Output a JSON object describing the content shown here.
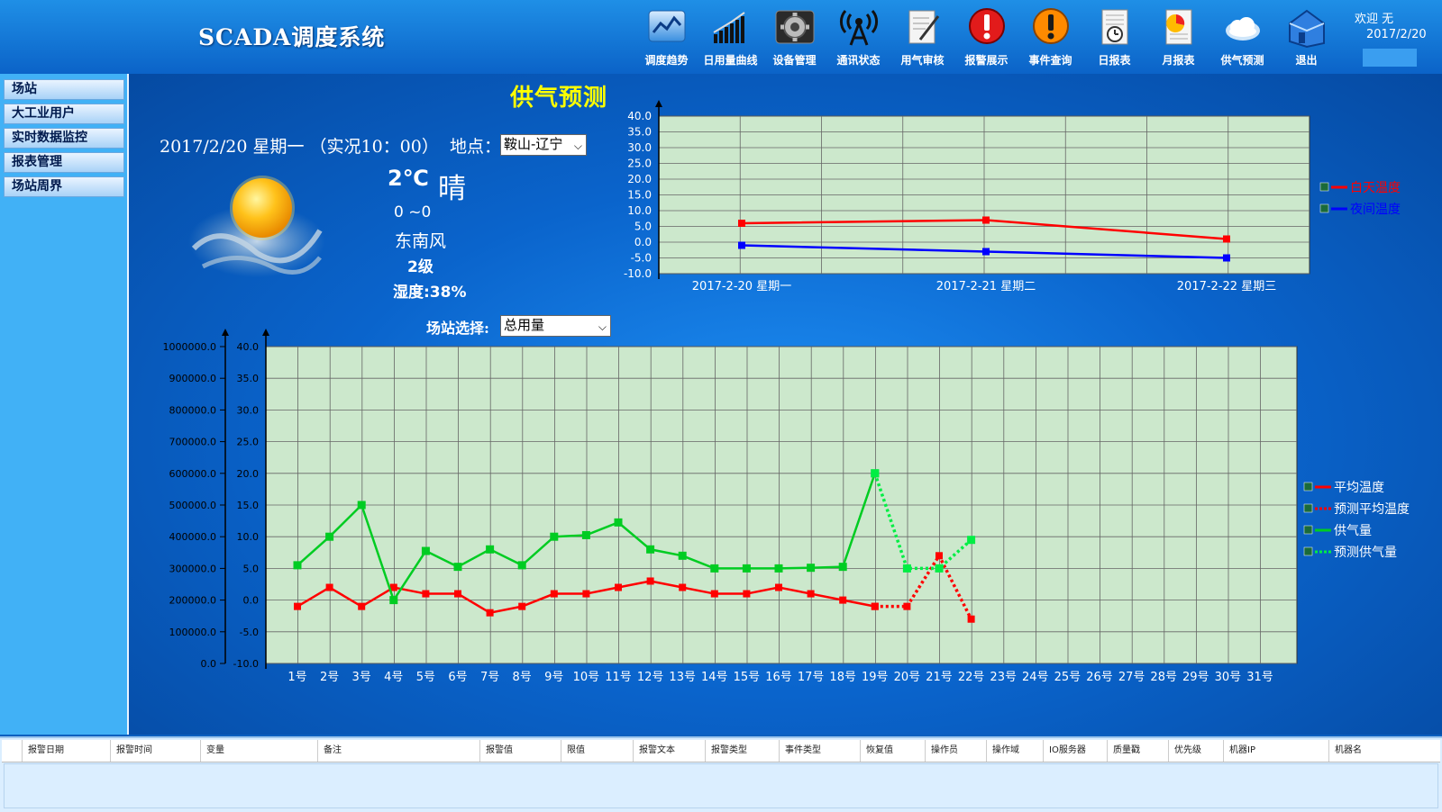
{
  "header": {
    "title": "SCADA调度系统",
    "welcome": "欢迎 无",
    "date": "2017/2/20",
    "toolbar": [
      {
        "label": "调度趋势",
        "icon": "trend-chart-icon"
      },
      {
        "label": "日用量曲线",
        "icon": "bar-chart-icon"
      },
      {
        "label": "设备管理",
        "icon": "gear-icon"
      },
      {
        "label": "通讯状态",
        "icon": "antenna-icon"
      },
      {
        "label": "用气审核",
        "icon": "document-pen-icon"
      },
      {
        "label": "报警展示",
        "icon": "alarm-icon"
      },
      {
        "label": "事件查询",
        "icon": "warning-icon"
      },
      {
        "label": "日报表",
        "icon": "daily-report-icon"
      },
      {
        "label": "月报表",
        "icon": "monthly-report-icon"
      },
      {
        "label": "供气预测",
        "icon": "cloud-icon"
      },
      {
        "label": "退出",
        "icon": "house-exit-icon"
      }
    ]
  },
  "sidebar": {
    "items": [
      {
        "label": "场站"
      },
      {
        "label": "大工业用户"
      },
      {
        "label": "实时数据监控"
      },
      {
        "label": "报表管理"
      },
      {
        "label": "场站周界"
      }
    ]
  },
  "main": {
    "title": "供气预测",
    "date_line": "2017/2/20  星期一  （实况10：00）",
    "location_label": "地点：",
    "location_value": "鞍山-辽宁",
    "weather": {
      "temp": "2℃",
      "condition": "晴",
      "range": "0  ~0",
      "wind": "东南风",
      "level": "2级",
      "humidity": "湿度:38%",
      "icon": "sun-icon"
    },
    "station_label": "场站选择:",
    "station_value": "总用量"
  },
  "colors": {
    "red": "#ff0000",
    "blue": "#0000ff",
    "green": "#00cc22",
    "plot_bg": "#cce8cc"
  },
  "chart_data": [
    {
      "type": "line",
      "categories": [
        "2017-2-20 星期一",
        "2017-2-21 星期二",
        "2017-2-22 星期三"
      ],
      "ylim": [
        -10,
        40
      ],
      "yticks": [
        "40.0",
        "35.0",
        "30.0",
        "25.0",
        "20.0",
        "15.0",
        "10.0",
        "5.0",
        "0.0",
        "-5.0",
        "-10.0"
      ],
      "grid": true,
      "legend_placement": "right",
      "series": [
        {
          "name": "白天温度",
          "color": "#ff0000",
          "style": "solid",
          "values": [
            6,
            7,
            1
          ]
        },
        {
          "name": "夜间温度",
          "color": "#0000ff",
          "style": "solid",
          "values": [
            -1,
            -3,
            -5
          ]
        }
      ]
    },
    {
      "type": "line",
      "categories": [
        "1号",
        "2号",
        "3号",
        "4号",
        "5号",
        "6号",
        "7号",
        "8号",
        "9号",
        "10号",
        "11号",
        "12号",
        "13号",
        "14号",
        "15号",
        "16号",
        "17号",
        "18号",
        "19号",
        "20号",
        "21号",
        "22号",
        "23号",
        "24号",
        "25号",
        "26号",
        "27号",
        "28号",
        "29号",
        "30号",
        "31号"
      ],
      "ylim_left": [
        0,
        1000000
      ],
      "yticks_left": [
        "1000000.0",
        "900000.0",
        "800000.0",
        "700000.0",
        "600000.0",
        "500000.0",
        "400000.0",
        "300000.0",
        "200000.0",
        "100000.0",
        "0.0"
      ],
      "ylim_right": [
        -10,
        40
      ],
      "yticks_right": [
        "40.0",
        "35.0",
        "30.0",
        "25.0",
        "20.0",
        "15.0",
        "10.0",
        "5.0",
        "0.0",
        "-5.0",
        "-10.0"
      ],
      "grid": true,
      "legend_placement": "right",
      "series": [
        {
          "name": "平均温度",
          "color": "#ff0000",
          "style": "solid",
          "axis": "right",
          "x_start": 1,
          "values": [
            -1,
            2,
            -1,
            2,
            1,
            1,
            -2,
            -1,
            1,
            1,
            2,
            3,
            2,
            1,
            1,
            2,
            1,
            0,
            -1
          ]
        },
        {
          "name": "预测平均温度",
          "color": "#ff0000",
          "style": "dotted",
          "axis": "right",
          "x_start": 19,
          "values": [
            -1,
            -1,
            7,
            -3
          ]
        },
        {
          "name": "供气量",
          "color": "#00cc22",
          "style": "solid",
          "axis": "left",
          "x_start": 1,
          "values": [
            310000,
            400000,
            500000,
            200000,
            355000,
            305000,
            360000,
            310000,
            400000,
            405000,
            445000,
            360000,
            340000,
            300000,
            300000,
            300000,
            302000,
            305000,
            600000
          ]
        },
        {
          "name": "预测供气量",
          "color": "#00ee44",
          "style": "dotted",
          "axis": "left",
          "x_start": 19,
          "values": [
            600000,
            300000,
            300000,
            390000
          ]
        }
      ]
    }
  ],
  "alarm_table": {
    "columns": [
      "报警日期",
      "报警时间",
      "变量",
      "备注",
      "报警值",
      "限值",
      "报警文本",
      "报警类型",
      "事件类型",
      "恢复值",
      "操作员",
      "操作域",
      "IO服务器",
      "质量戳",
      "优先级",
      "机器IP",
      "机器名"
    ]
  }
}
